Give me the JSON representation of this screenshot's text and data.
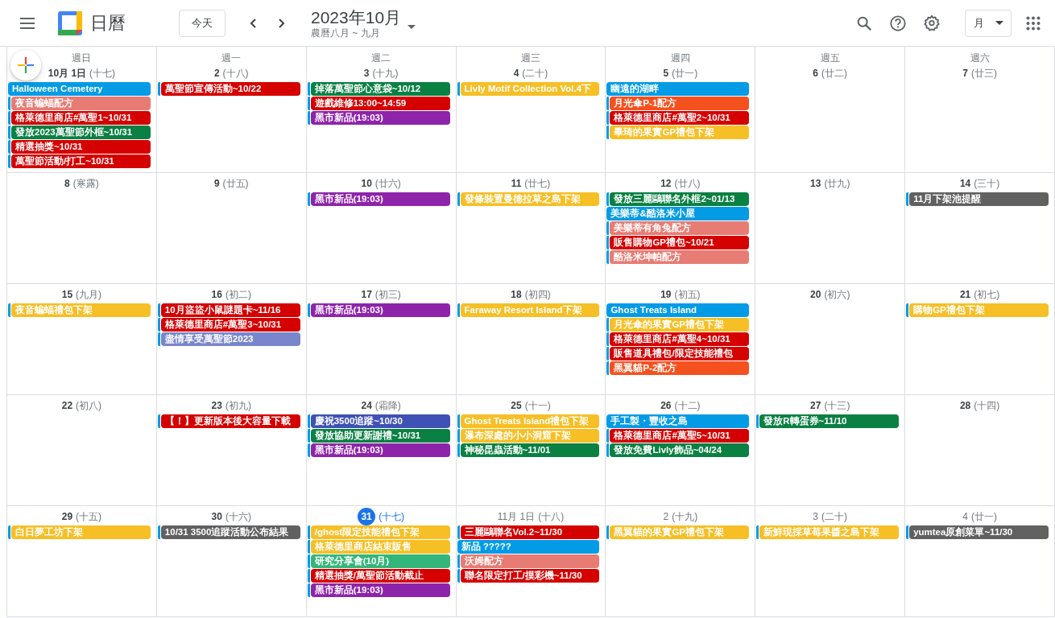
{
  "app": {
    "name": "日曆"
  },
  "toolbar": {
    "today_button": "今天",
    "title": "2023年10月",
    "subtitle": "農曆八月 ~ 九月",
    "view_button": "月"
  },
  "weekdays": [
    "週日",
    "週一",
    "週二",
    "週三",
    "週四",
    "週五",
    "週六"
  ],
  "weeks": [
    {
      "days": [
        {
          "date": "10月 1日",
          "lunar": "(十七)",
          "in_month": true,
          "today": false,
          "events": [
            {
              "title": "Halloween Cemetery",
              "color": "#039be5",
              "calendar_marker": false
            },
            {
              "title": "夜音蝙蝠配方",
              "color": "#e67c73",
              "calendar_marker": true
            },
            {
              "title": "格萊德里商店#萬聖1~10/31",
              "color": "#d50000",
              "calendar_marker": true
            },
            {
              "title": "發放2023萬聖節外框~10/31",
              "color": "#0b8043",
              "calendar_marker": true
            },
            {
              "title": "精選抽獎~10/31",
              "color": "#d50000",
              "calendar_marker": true
            },
            {
              "title": "萬聖節活動/打工~10/31",
              "color": "#d50000",
              "calendar_marker": true
            }
          ]
        },
        {
          "date": "2",
          "lunar": "(十八)",
          "in_month": true,
          "today": false,
          "events": [
            {
              "title": "萬聖節宣傳活動~10/22",
              "color": "#d50000",
              "calendar_marker": true
            }
          ]
        },
        {
          "date": "3",
          "lunar": "(十九)",
          "in_month": true,
          "today": false,
          "events": [
            {
              "title": "掉落萬聖節心意袋~10/12",
              "color": "#0b8043",
              "calendar_marker": true
            },
            {
              "title": "遊戲維修13:00~14:59",
              "color": "#d50000",
              "calendar_marker": true
            },
            {
              "title": "黑市新品(19:03)",
              "color": "#8e24aa",
              "calendar_marker": true
            }
          ]
        },
        {
          "date": "4",
          "lunar": "(二十)",
          "in_month": true,
          "today": false,
          "events": [
            {
              "title": "Livly Motif Collection Vol.4下",
              "color": "#f6bf26",
              "calendar_marker": true
            }
          ]
        },
        {
          "date": "5",
          "lunar": "(廿一)",
          "in_month": true,
          "today": false,
          "events": [
            {
              "title": "幽遠的湖畔",
              "color": "#039be5",
              "calendar_marker": false
            },
            {
              "title": "月光傘P-1配方",
              "color": "#f4511e",
              "calendar_marker": true
            },
            {
              "title": "格萊德里商店#萬聖2~10/31",
              "color": "#d50000",
              "calendar_marker": true
            },
            {
              "title": "畢琦的果實GP禮包下架",
              "color": "#f6bf26",
              "calendar_marker": true
            }
          ]
        },
        {
          "date": "6",
          "lunar": "(廿二)",
          "in_month": true,
          "today": false
        },
        {
          "date": "7",
          "lunar": "(廿三)",
          "in_month": true,
          "today": false
        }
      ]
    },
    {
      "days": [
        {
          "date": "8",
          "lunar": "(寒露)",
          "in_month": true,
          "today": false
        },
        {
          "date": "9",
          "lunar": "(廿五)",
          "in_month": true,
          "today": false
        },
        {
          "date": "10",
          "lunar": "(廿六)",
          "in_month": true,
          "today": false,
          "events": [
            {
              "title": "黑市新品(19:03)",
              "color": "#8e24aa",
              "calendar_marker": true
            }
          ]
        },
        {
          "date": "11",
          "lunar": "(廿七)",
          "in_month": true,
          "today": false,
          "events": [
            {
              "title": "發條裝置曼德拉草之島下架",
              "color": "#f6bf26",
              "calendar_marker": true
            }
          ]
        },
        {
          "date": "12",
          "lunar": "(廿八)",
          "in_month": true,
          "today": false,
          "events": [
            {
              "title": "發放三麗鷗聯名外框2~01/13",
              "color": "#0b8043",
              "calendar_marker": true
            },
            {
              "title": "美樂蒂&酷洛米小屋",
              "color": "#039be5",
              "calendar_marker": false
            },
            {
              "title": "美樂蒂有角兔配方",
              "color": "#e67c73",
              "calendar_marker": true
            },
            {
              "title": "販售購物GP禮包~10/21",
              "color": "#d50000",
              "calendar_marker": true
            },
            {
              "title": "酷洛米坤帕配方",
              "color": "#e67c73",
              "calendar_marker": true
            }
          ]
        },
        {
          "date": "13",
          "lunar": "(廿九)",
          "in_month": true,
          "today": false
        },
        {
          "date": "14",
          "lunar": "(三十)",
          "in_month": true,
          "today": false,
          "events": [
            {
              "title": "11月下架池提醒",
              "color": "#616161",
              "calendar_marker": true
            }
          ]
        }
      ]
    },
    {
      "days": [
        {
          "date": "15",
          "lunar": "(九月)",
          "in_month": true,
          "today": false,
          "events": [
            {
              "title": "夜音蝙蝠禮包下架",
              "color": "#f6bf26",
              "calendar_marker": true
            }
          ]
        },
        {
          "date": "16",
          "lunar": "(初二)",
          "in_month": true,
          "today": false,
          "events": [
            {
              "title": "10月盜盜小鼠謎題卡~11/16",
              "color": "#d50000",
              "calendar_marker": true
            },
            {
              "title": "格萊德里商店#萬聖3~10/31",
              "color": "#d50000",
              "calendar_marker": true
            },
            {
              "title": "盡情享受萬聖節2023",
              "color": "#7986cb",
              "calendar_marker": true
            }
          ]
        },
        {
          "date": "17",
          "lunar": "(初三)",
          "in_month": true,
          "today": false,
          "events": [
            {
              "title": "黑市新品(19:03)",
              "color": "#8e24aa",
              "calendar_marker": true
            }
          ]
        },
        {
          "date": "18",
          "lunar": "(初四)",
          "in_month": true,
          "today": false,
          "events": [
            {
              "title": "Faraway Resort Island下架",
              "color": "#f6bf26",
              "calendar_marker": true
            }
          ]
        },
        {
          "date": "19",
          "lunar": "(初五)",
          "in_month": true,
          "today": false,
          "events": [
            {
              "title": "Ghost Treats Island",
              "color": "#039be5",
              "calendar_marker": false
            },
            {
              "title": "月光傘的果實GP禮包下架",
              "color": "#f6bf26",
              "calendar_marker": true
            },
            {
              "title": "格萊德里商店#萬聖4~10/31",
              "color": "#d50000",
              "calendar_marker": true
            },
            {
              "title": "販售道具禮包/限定技能禮包",
              "color": "#d50000",
              "calendar_marker": true
            },
            {
              "title": "黑翼貓P-2配方",
              "color": "#f4511e",
              "calendar_marker": true
            }
          ]
        },
        {
          "date": "20",
          "lunar": "(初六)",
          "in_month": true,
          "today": false
        },
        {
          "date": "21",
          "lunar": "(初七)",
          "in_month": true,
          "today": false,
          "events": [
            {
              "title": "購物GP禮包下架",
              "color": "#f6bf26",
              "calendar_marker": true
            }
          ]
        }
      ]
    },
    {
      "days": [
        {
          "date": "22",
          "lunar": "(初八)",
          "in_month": true,
          "today": false
        },
        {
          "date": "23",
          "lunar": "(初九)",
          "in_month": true,
          "today": false,
          "events": [
            {
              "title": "【！】更新版本後大容量下載",
              "color": "#d50000",
              "calendar_marker": true
            }
          ]
        },
        {
          "date": "24",
          "lunar": "(霜降)",
          "in_month": true,
          "today": false,
          "events": [
            {
              "title": "慶祝3500追蹤~10/30",
              "color": "#3f51b5",
              "calendar_marker": true
            },
            {
              "title": "發放協助更新謝禮~10/31",
              "color": "#0b8043",
              "calendar_marker": true
            },
            {
              "title": "黑市新品(19:03)",
              "color": "#8e24aa",
              "calendar_marker": true
            }
          ]
        },
        {
          "date": "25",
          "lunar": "(十一)",
          "in_month": true,
          "today": false,
          "events": [
            {
              "title": "Ghost Treats Island禮包下架",
              "color": "#f6bf26",
              "calendar_marker": true
            },
            {
              "title": "瀑布深處的小小洞窟下架",
              "color": "#f6bf26",
              "calendar_marker": true
            },
            {
              "title": "神秘昆蟲活動~11/01",
              "color": "#0b8043",
              "calendar_marker": true
            }
          ]
        },
        {
          "date": "26",
          "lunar": "(十二)",
          "in_month": true,
          "today": false,
          "events": [
            {
              "title": "手工製・豐收之島",
              "color": "#039be5",
              "calendar_marker": false
            },
            {
              "title": "格萊德里商店#萬聖5~10/31",
              "color": "#d50000",
              "calendar_marker": true
            },
            {
              "title": "發放免費Livly飾品~04/24",
              "color": "#0b8043",
              "calendar_marker": true
            }
          ]
        },
        {
          "date": "27",
          "lunar": "(十三)",
          "in_month": true,
          "today": false,
          "events": [
            {
              "title": "發放R轉蛋券~11/10",
              "color": "#0b8043",
              "calendar_marker": true
            }
          ]
        },
        {
          "date": "28",
          "lunar": "(十四)",
          "in_month": true,
          "today": false
        }
      ]
    },
    {
      "days": [
        {
          "date": "29",
          "lunar": "(十五)",
          "in_month": true,
          "today": false,
          "events": [
            {
              "title": "白日夢工坊下架",
              "color": "#f6bf26",
              "calendar_marker": true
            }
          ]
        },
        {
          "date": "30",
          "lunar": "(十六)",
          "in_month": true,
          "today": false,
          "events": [
            {
              "title": "10/31 3500追蹤活動公布結果",
              "color": "#616161",
              "calendar_marker": true
            }
          ]
        },
        {
          "date": "31",
          "lunar": "(十七)",
          "in_month": true,
          "today": true,
          "events": [
            {
              "title": "/ghost限定技能禮包下架",
              "color": "#f6bf26",
              "calendar_marker": true
            },
            {
              "title": "格萊德里商店結束販售",
              "color": "#f6bf26",
              "calendar_marker": true
            },
            {
              "title": "研究分享會(10月)",
              "color": "#33b679",
              "calendar_marker": true
            },
            {
              "title": "精選抽獎/萬聖節活動截止",
              "color": "#d50000",
              "calendar_marker": true
            },
            {
              "title": "黑市新品(19:03)",
              "color": "#8e24aa",
              "calendar_marker": true
            }
          ]
        },
        {
          "date": "11月 1日",
          "lunar": "(十八)",
          "in_month": false,
          "today": false,
          "events": [
            {
              "title": "三麗鷗聯名Vol.2~11/30",
              "color": "#d50000",
              "calendar_marker": true
            },
            {
              "title": "新品 ?????",
              "color": "#039be5",
              "calendar_marker": false
            },
            {
              "title": "沃姆配方",
              "color": "#e67c73",
              "calendar_marker": true
            },
            {
              "title": "聯名限定打工/摸彩機~11/30",
              "color": "#d50000",
              "calendar_marker": true
            }
          ]
        },
        {
          "date": "2",
          "lunar": "(十九)",
          "in_month": false,
          "today": false,
          "events": [
            {
              "title": "黑翼貓的果實GP禮包下架",
              "color": "#f6bf26",
              "calendar_marker": true
            }
          ]
        },
        {
          "date": "3",
          "lunar": "(二十)",
          "in_month": false,
          "today": false,
          "events": [
            {
              "title": "新鮮現採草莓果醬之島下架",
              "color": "#f6bf26",
              "calendar_marker": true
            }
          ]
        },
        {
          "date": "4",
          "lunar": "(廿一)",
          "in_month": false,
          "today": false,
          "events": [
            {
              "title": "yumtea原創菜單~11/30",
              "color": "#616161",
              "calendar_marker": true
            }
          ]
        }
      ]
    }
  ]
}
